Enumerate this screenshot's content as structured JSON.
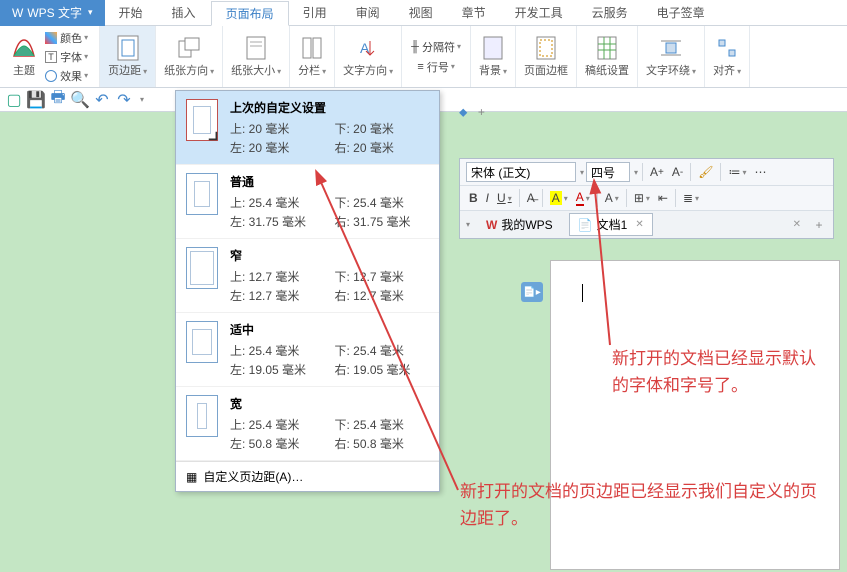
{
  "app": {
    "name": "WPS 文字"
  },
  "menuTabs": [
    "开始",
    "插入",
    "页面布局",
    "引用",
    "审阅",
    "视图",
    "章节",
    "开发工具",
    "云服务",
    "电子签章"
  ],
  "activeMenuTab": "页面布局",
  "ribbon": {
    "theme": "主题",
    "color": "颜色",
    "font": "字体",
    "effect": "效果",
    "margin": "页边距",
    "orientation": "纸张方向",
    "size": "纸张大小",
    "columns": "分栏",
    "textDir": "文字方向",
    "breaks": "分隔符",
    "lineNum": "行号",
    "background": "背景",
    "pageBorder": "页面边框",
    "manuscript": "稿纸设置",
    "wrap": "文字环绕",
    "align": "对齐"
  },
  "marginPresets": [
    {
      "title": "上次的自定义设置",
      "top": "上: 20 毫米",
      "bottom": "下: 20 毫米",
      "left": "左: 20 毫米",
      "right": "右: 20 毫米"
    },
    {
      "title": "普通",
      "top": "上: 25.4 毫米",
      "bottom": "下: 25.4 毫米",
      "left": "左: 31.75 毫米",
      "right": "右: 31.75 毫米"
    },
    {
      "title": "窄",
      "top": "上: 12.7 毫米",
      "bottom": "下: 12.7 毫米",
      "left": "左: 12.7 毫米",
      "right": "右: 12.7 毫米"
    },
    {
      "title": "适中",
      "top": "上: 25.4 毫米",
      "bottom": "下: 25.4 毫米",
      "left": "左: 19.05 毫米",
      "right": "右: 19.05 毫米"
    },
    {
      "title": "宽",
      "top": "上: 25.4 毫米",
      "bottom": "下: 25.4 毫米",
      "left": "左: 50.8 毫米",
      "right": "右: 50.8 毫米"
    }
  ],
  "customMargin": "自定义页边距(A)…",
  "floatToolbar": {
    "fontName": "宋体 (正文)",
    "fontSize": "四号",
    "bold": "B",
    "italic": "I",
    "underline": "U"
  },
  "docTabs": {
    "home": "我的WPS",
    "doc1": "文档1"
  },
  "annotations": {
    "font": "新打开的文档已经显示默认的字体和字号了。",
    "margin": "新打开的文档的页边距已经显示我们自定义的页边距了。"
  }
}
